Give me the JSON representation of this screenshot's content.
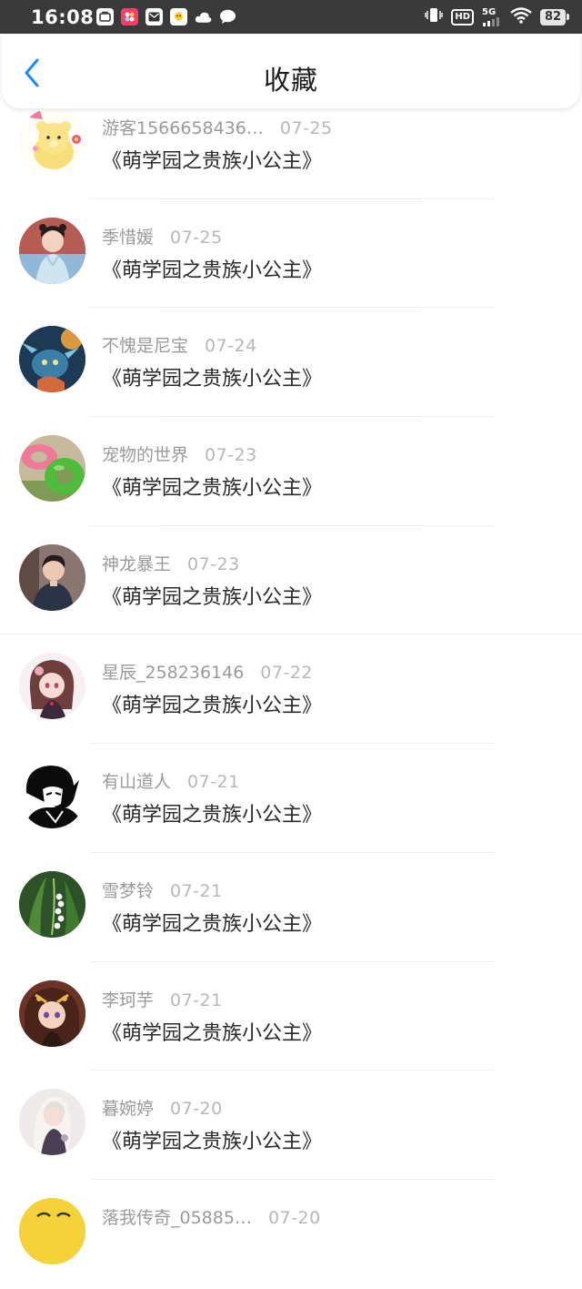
{
  "status_bar": {
    "time": "16:08",
    "hd": "HD",
    "network": "5G",
    "battery": "82"
  },
  "header": {
    "title": "收藏"
  },
  "colors": {
    "accent": "#1a8cff",
    "status_bar_bg": "#3a3a3a"
  },
  "items": [
    {
      "user": "游客1566658436…",
      "date": "07-25",
      "title": "《萌学园之贵族小公主》",
      "avatar": "bear-sticker"
    },
    {
      "user": "季惜媛",
      "date": "07-25",
      "title": "《萌学园之贵族小公主》",
      "avatar": "girl-hanfu"
    },
    {
      "user": "不愧是尼宝",
      "date": "07-24",
      "title": "《萌学园之贵族小公主》",
      "avatar": "game-hero"
    },
    {
      "user": "宠物的世界",
      "date": "07-23",
      "title": "《萌学园之贵族小公主》",
      "avatar": "swim-rings"
    },
    {
      "user": "神龙暴王",
      "date": "07-23",
      "title": "《萌学园之贵族小公主》",
      "avatar": "young-man"
    },
    {
      "user": "星辰_258236146",
      "date": "07-22",
      "title": "《萌学园之贵族小公主》",
      "avatar": "anime-girl-pink"
    },
    {
      "user": "有山道人",
      "date": "07-21",
      "title": "《萌学园之贵族小公主》",
      "avatar": "anime-boy-bw"
    },
    {
      "user": "雪梦铃",
      "date": "07-21",
      "title": "《萌学园之贵族小公主》",
      "avatar": "lily-of-valley"
    },
    {
      "user": "李珂芋",
      "date": "07-21",
      "title": "《萌学园之贵族小公主》",
      "avatar": "anime-girl-gold"
    },
    {
      "user": "暮婉婷",
      "date": "07-20",
      "title": "《萌学园之贵族小公主》",
      "avatar": "anime-girl-white"
    },
    {
      "user": "落我传奇_05885…",
      "date": "07-20",
      "title": "",
      "avatar": "yellow-cartoon"
    }
  ]
}
